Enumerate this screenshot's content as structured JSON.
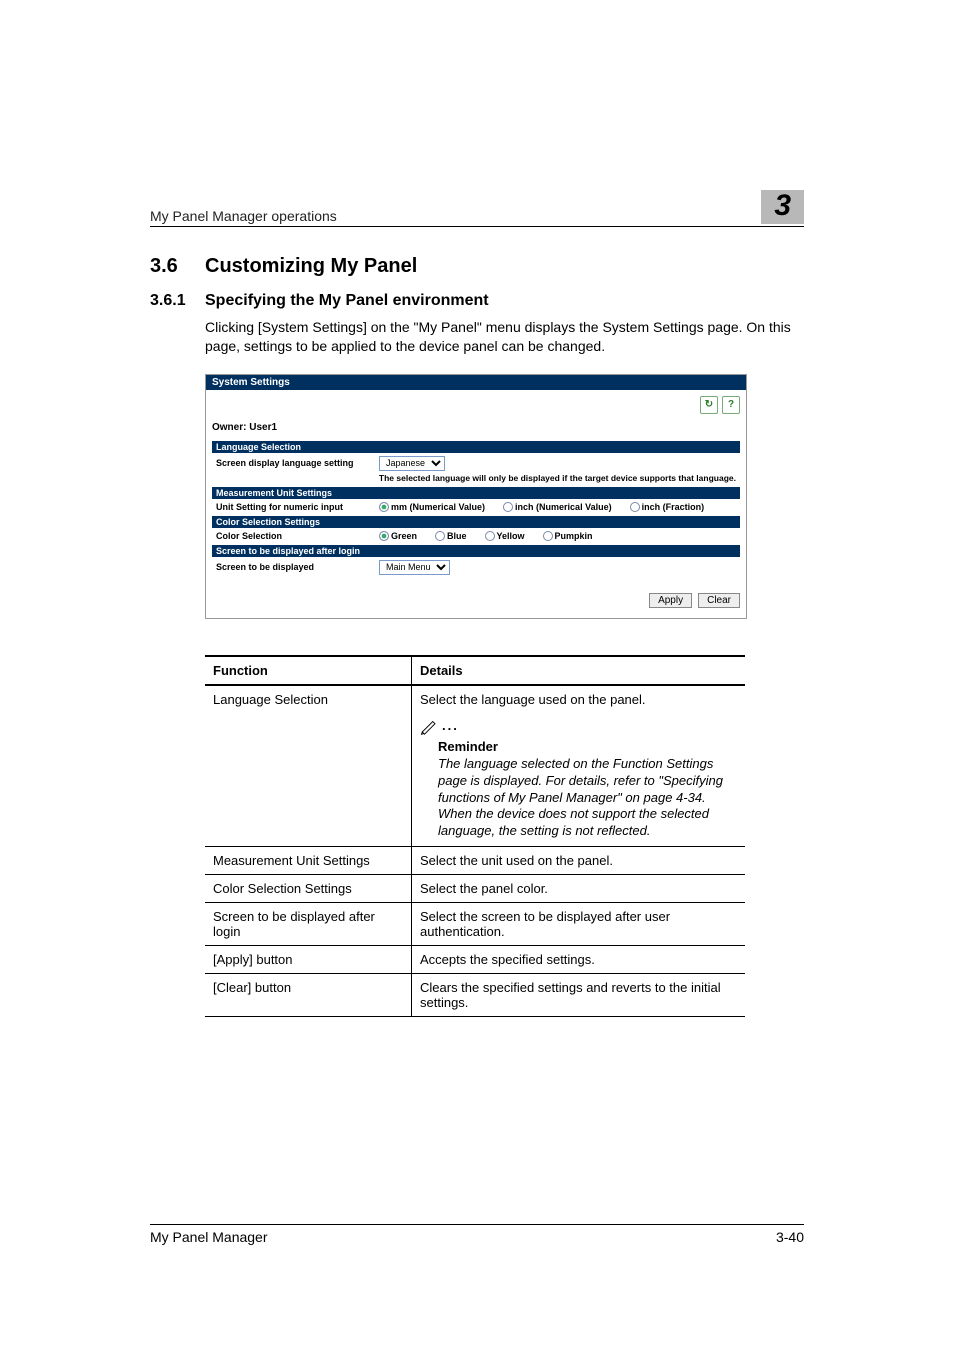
{
  "header": {
    "running_title": "My Panel Manager operations",
    "chapter_number": "3"
  },
  "section": {
    "number": "3.6",
    "title": "Customizing My Panel"
  },
  "subsection": {
    "number": "3.6.1",
    "title": "Specifying the My Panel environment"
  },
  "paragraph": "Clicking [System Settings] on the \"My Panel\" menu displays the System Settings page. On this page, settings to be applied to the device panel can be changed.",
  "panel": {
    "window_title": "System Settings",
    "owner_label": "Owner: User1",
    "refresh_icon": "↻",
    "help_icon": "?",
    "language": {
      "section_label": "Language Selection",
      "field_label": "Screen display language setting",
      "value": "Japanese",
      "note": "The selected language will only be displayed if the target device supports that language."
    },
    "measurement": {
      "section_label": "Measurement Unit Settings",
      "field_label": "Unit Setting for numeric input",
      "options": [
        "mm (Numerical Value)",
        "inch (Numerical Value)",
        "inch (Fraction)"
      ],
      "selected_index": 0
    },
    "color": {
      "section_label": "Color Selection Settings",
      "field_label": "Color Selection",
      "options": [
        "Green",
        "Blue",
        "Yellow",
        "Pumpkin"
      ],
      "selected_index": 0
    },
    "after_login": {
      "section_label": "Screen to be displayed after login",
      "field_label": "Screen to be displayed",
      "value": "Main Menu"
    },
    "buttons": {
      "apply": "Apply",
      "clear": "Clear"
    }
  },
  "table": {
    "headers": {
      "function": "Function",
      "details": "Details"
    },
    "rows": [
      {
        "function": "Language Selection",
        "details": "Select the language used on the panel.",
        "reminder": {
          "title": "Reminder",
          "body": "The language selected on the Function Settings page is displayed. For details, refer to \"Specifying functions of My Panel Manager\" on page 4-34. When the device does not support the selected language, the setting is not reflected."
        }
      },
      {
        "function": "Measurement Unit Settings",
        "details": "Select the unit used on the panel."
      },
      {
        "function": "Color Selection Settings",
        "details": "Select the panel color."
      },
      {
        "function": "Screen to be displayed after login",
        "details": "Select the screen to be displayed after user authentication."
      },
      {
        "function": "[Apply] button",
        "details": "Accepts the specified settings."
      },
      {
        "function": "[Clear] button",
        "details": "Clears the specified settings and reverts to the initial settings."
      }
    ]
  },
  "footer": {
    "left": "My Panel Manager",
    "right": "3-40"
  }
}
